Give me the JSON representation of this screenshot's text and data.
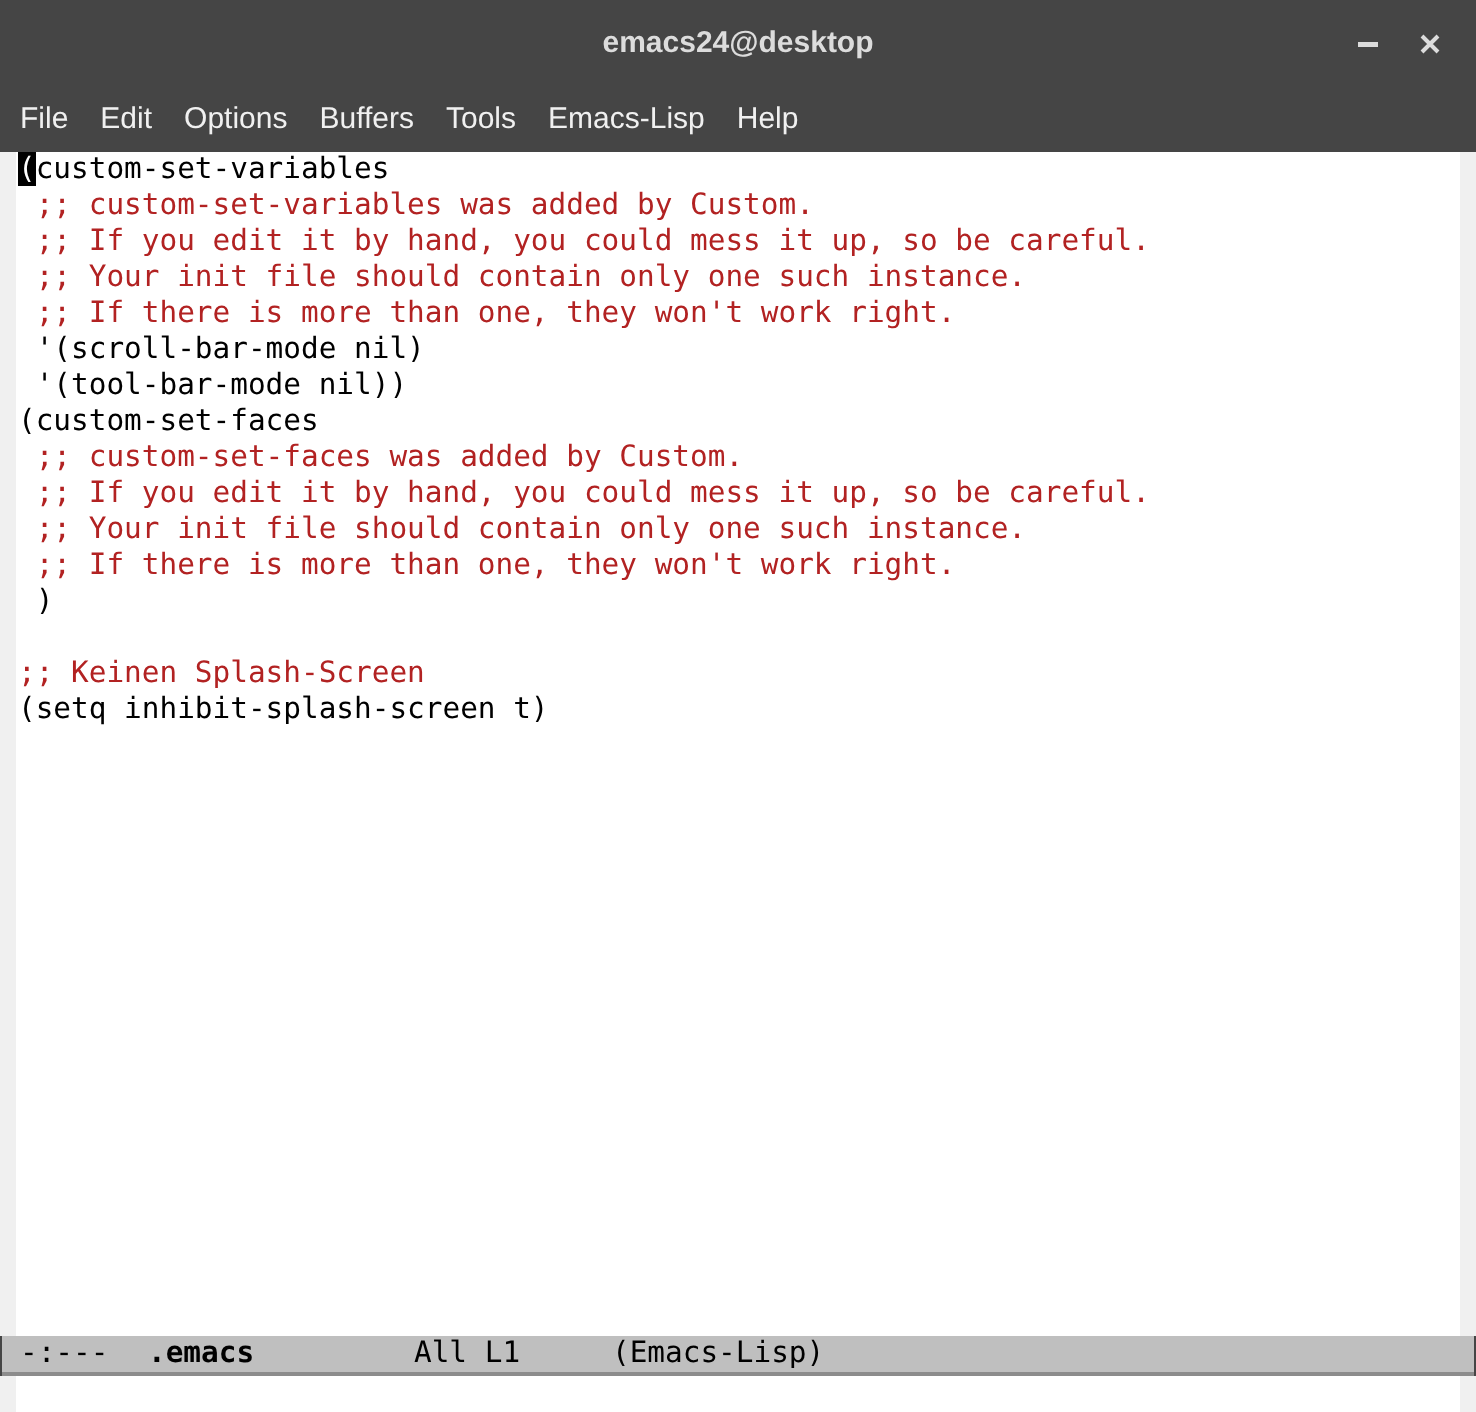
{
  "window": {
    "title": "emacs24@desktop"
  },
  "menu_bar": [
    "File",
    "Edit",
    "Options",
    "Buffers",
    "Tools",
    "Emacs-Lisp",
    "Help"
  ],
  "buffer": {
    "lines": [
      {
        "kind": "code",
        "text": "(custom-set-variables",
        "cursor": true
      },
      {
        "kind": "comment",
        "text": " ;; custom-set-variables was added by Custom.",
        "cursor": false
      },
      {
        "kind": "comment",
        "text": " ;; If you edit it by hand, you could mess it up, so be careful.",
        "cursor": false
      },
      {
        "kind": "comment",
        "text": " ;; Your init file should contain only one such instance.",
        "cursor": false
      },
      {
        "kind": "comment",
        "text": " ;; If there is more than one, they won't work right.",
        "cursor": false
      },
      {
        "kind": "code",
        "text": " '(scroll-bar-mode nil)",
        "cursor": false
      },
      {
        "kind": "code",
        "text": " '(tool-bar-mode nil))",
        "cursor": false
      },
      {
        "kind": "code",
        "text": "(custom-set-faces",
        "cursor": false
      },
      {
        "kind": "comment",
        "text": " ;; custom-set-faces was added by Custom.",
        "cursor": false
      },
      {
        "kind": "comment",
        "text": " ;; If you edit it by hand, you could mess it up, so be careful.",
        "cursor": false
      },
      {
        "kind": "comment",
        "text": " ;; Your init file should contain only one such instance.",
        "cursor": false
      },
      {
        "kind": "comment",
        "text": " ;; If there is more than one, they won't work right.",
        "cursor": false
      },
      {
        "kind": "code",
        "text": " )",
        "cursor": false
      },
      {
        "kind": "blank",
        "cursor": false
      },
      {
        "kind": "comment",
        "text": ";; Keinen Splash-Screen",
        "cursor": false
      },
      {
        "kind": "code",
        "text": "(setq inhibit-splash-screen t)",
        "cursor": false
      }
    ]
  },
  "mode_line": {
    "status": "-:---",
    "buffer_name": ".emacs",
    "position": "All L1",
    "mode": "(Emacs-Lisp)"
  }
}
